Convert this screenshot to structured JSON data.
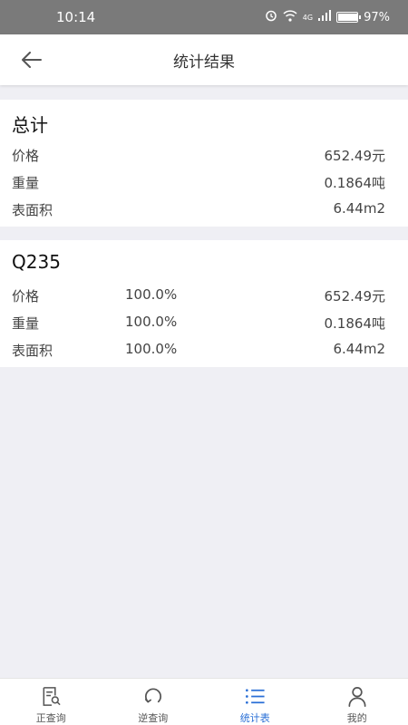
{
  "status_bar": {
    "time": "10:14",
    "network": "4G",
    "battery": "97%"
  },
  "header": {
    "title": "统计结果",
    "back_icon": "arrow-left-icon"
  },
  "summary": {
    "title": "总计",
    "rows": [
      {
        "label": "价格",
        "value": "652.49元"
      },
      {
        "label": "重量",
        "value": "0.1864吨"
      },
      {
        "label": "表面积",
        "value": "6.44m2"
      }
    ]
  },
  "material": {
    "title": "Q235",
    "rows": [
      {
        "label": "价格",
        "percent": "100.0%",
        "value": "652.49元"
      },
      {
        "label": "重量",
        "percent": "100.0%",
        "value": "0.1864吨"
      },
      {
        "label": "表面积",
        "percent": "100.0%",
        "value": "6.44m2"
      }
    ]
  },
  "tabs": [
    {
      "label": "正查询",
      "icon": "document-search-icon",
      "active": false
    },
    {
      "label": "逆查询",
      "icon": "refresh-circle-icon",
      "active": false
    },
    {
      "label": "统计表",
      "icon": "list-icon",
      "active": true
    },
    {
      "label": "我的",
      "icon": "user-icon",
      "active": false
    }
  ],
  "colors": {
    "accent": "#2a6fd6",
    "status_bar": "#7a7a7a",
    "background": "#efeff4"
  }
}
